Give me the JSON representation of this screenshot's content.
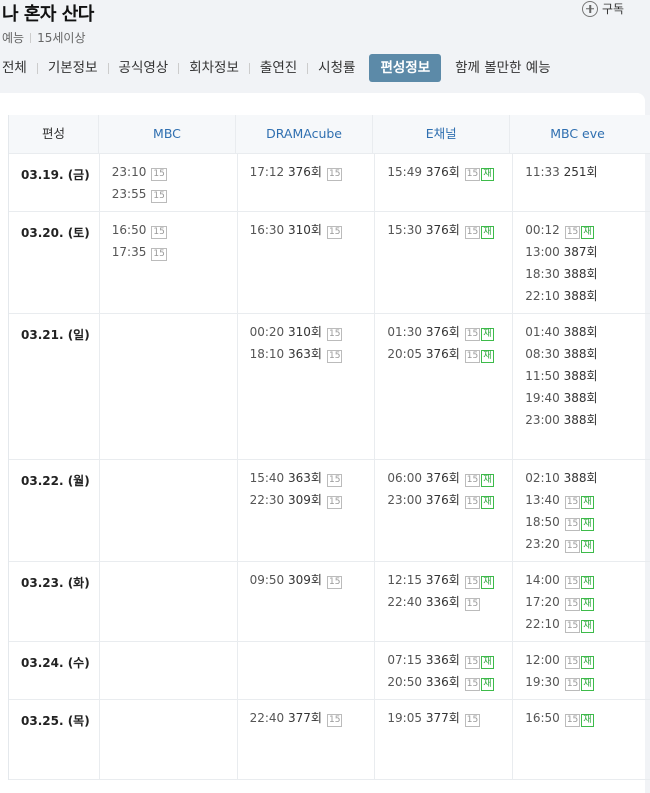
{
  "program": {
    "title": "나 혼자 산다",
    "genre": "예능",
    "rating": "15세이상",
    "subscribe_label": "구독"
  },
  "tabs": [
    "전체",
    "기본정보",
    "공식영상",
    "회차정보",
    "출연진",
    "시청률",
    "편성정보",
    "함께 볼만한 예능"
  ],
  "active_tab": "편성정보",
  "table": {
    "headers": [
      "편성",
      "MBC",
      "DRAMAcube",
      "E채널",
      "MBC eve"
    ],
    "rows": [
      {
        "date": "03.19. (금)",
        "cols": [
          [
            {
              "time": "23:10",
              "ep": "",
              "age": "15",
              "re": ""
            },
            {
              "time": "23:55",
              "ep": "",
              "age": "15",
              "re": ""
            }
          ],
          [
            {
              "time": "17:12",
              "ep": "376회",
              "age": "15",
              "re": ""
            }
          ],
          [
            {
              "time": "15:49",
              "ep": "376회",
              "age": "15",
              "re": "재"
            }
          ],
          [
            {
              "time": "11:33",
              "ep": "251회",
              "age": "",
              "re": ""
            }
          ]
        ]
      },
      {
        "date": "03.20. (토)",
        "cols": [
          [
            {
              "time": "16:50",
              "ep": "",
              "age": "15",
              "re": ""
            },
            {
              "time": "17:35",
              "ep": "",
              "age": "15",
              "re": ""
            }
          ],
          [
            {
              "time": "16:30",
              "ep": "310회",
              "age": "15",
              "re": ""
            }
          ],
          [
            {
              "time": "15:30",
              "ep": "376회",
              "age": "15",
              "re": "재"
            }
          ],
          [
            {
              "time": "00:12",
              "ep": "",
              "age": "15",
              "re": "재"
            },
            {
              "time": "13:00",
              "ep": "387회",
              "age": "",
              "re": ""
            },
            {
              "time": "18:30",
              "ep": "388회",
              "age": "",
              "re": ""
            },
            {
              "time": "22:10",
              "ep": "388회",
              "age": "",
              "re": ""
            }
          ]
        ]
      },
      {
        "date": "03.21. (일)",
        "cols": [
          [],
          [
            {
              "time": "00:20",
              "ep": "310회",
              "age": "15",
              "re": ""
            },
            {
              "time": "18:10",
              "ep": "363회",
              "age": "15",
              "re": ""
            }
          ],
          [
            {
              "time": "01:30",
              "ep": "376회",
              "age": "15",
              "re": "재"
            },
            {
              "time": "20:05",
              "ep": "376회",
              "age": "15",
              "re": "재"
            }
          ],
          [
            {
              "time": "01:40",
              "ep": "388회",
              "age": "",
              "re": ""
            },
            {
              "time": "08:30",
              "ep": "388회",
              "age": "",
              "re": ""
            },
            {
              "time": "11:50",
              "ep": "388회",
              "age": "",
              "re": ""
            },
            {
              "time": "19:40",
              "ep": "388회",
              "age": "",
              "re": ""
            },
            {
              "time": "23:00",
              "ep": "388회",
              "age": "",
              "re": ""
            }
          ]
        ]
      },
      {
        "date": "03.22. (월)",
        "cols": [
          [],
          [
            {
              "time": "15:40",
              "ep": "363회",
              "age": "15",
              "re": ""
            },
            {
              "time": "22:30",
              "ep": "309회",
              "age": "15",
              "re": ""
            }
          ],
          [
            {
              "time": "06:00",
              "ep": "376회",
              "age": "15",
              "re": "재"
            },
            {
              "time": "23:00",
              "ep": "376회",
              "age": "15",
              "re": "재"
            }
          ],
          [
            {
              "time": "02:10",
              "ep": "388회",
              "age": "",
              "re": ""
            },
            {
              "time": "13:40",
              "ep": "",
              "age": "15",
              "re": "재"
            },
            {
              "time": "18:50",
              "ep": "",
              "age": "15",
              "re": "재"
            },
            {
              "time": "23:20",
              "ep": "",
              "age": "15",
              "re": "재"
            }
          ]
        ]
      },
      {
        "date": "03.23. (화)",
        "cols": [
          [],
          [
            {
              "time": "09:50",
              "ep": "309회",
              "age": "15",
              "re": ""
            }
          ],
          [
            {
              "time": "12:15",
              "ep": "376회",
              "age": "15",
              "re": "재"
            },
            {
              "time": "22:40",
              "ep": "336회",
              "age": "15",
              "re": ""
            }
          ],
          [
            {
              "time": "14:00",
              "ep": "",
              "age": "15",
              "re": "재"
            },
            {
              "time": "17:20",
              "ep": "",
              "age": "15",
              "re": "재"
            },
            {
              "time": "22:10",
              "ep": "",
              "age": "15",
              "re": "재"
            }
          ]
        ]
      },
      {
        "date": "03.24. (수)",
        "cols": [
          [],
          [],
          [
            {
              "time": "07:15",
              "ep": "336회",
              "age": "15",
              "re": "재"
            },
            {
              "time": "20:50",
              "ep": "336회",
              "age": "15",
              "re": "재"
            }
          ],
          [
            {
              "time": "12:00",
              "ep": "",
              "age": "15",
              "re": "재"
            },
            {
              "time": "19:30",
              "ep": "",
              "age": "15",
              "re": "재"
            }
          ]
        ]
      },
      {
        "date": "03.25. (목)",
        "cols": [
          [],
          [
            {
              "time": "22:40",
              "ep": "377회",
              "age": "15",
              "re": ""
            }
          ],
          [
            {
              "time": "19:05",
              "ep": "377회",
              "age": "15",
              "re": ""
            }
          ],
          [
            {
              "time": "16:50",
              "ep": "",
              "age": "15",
              "re": "재"
            }
          ]
        ]
      }
    ]
  }
}
